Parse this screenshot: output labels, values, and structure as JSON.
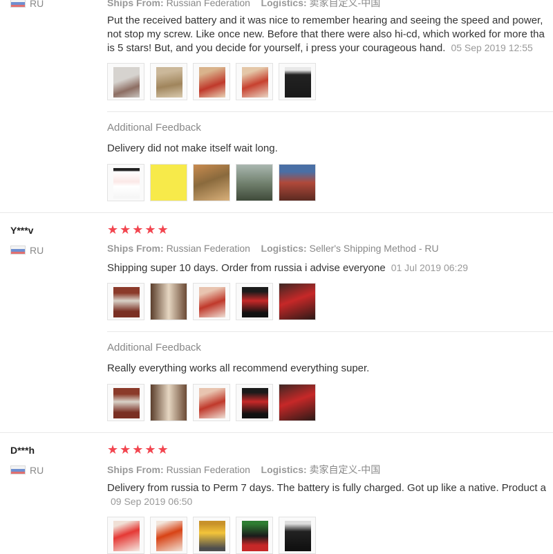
{
  "reviews": [
    {
      "country": "RU",
      "ships_label": "Ships From:",
      "ships_value": "Russian Federation",
      "logistics_label": "Logistics:",
      "logistics_value": "卖家自定义-中国",
      "text1": "Put the received battery and it was nice to remember hearing and seeing the speed and power,",
      "text2": "not stop my screw. Like once new. Before that there were also hi-cd, which worked for more tha",
      "text3": "is 5 stars! But, and you decide for yourself, i press your courageous hand.",
      "date": "05 Sep 2019 12:55",
      "additional": {
        "label": "Additional Feedback",
        "text": "Delivery did not make itself wait long."
      }
    },
    {
      "name": "Y***v",
      "country": "RU",
      "stars": "★★★★★",
      "ships_label": "Ships From:",
      "ships_value": "Russian Federation",
      "logistics_label": "Logistics:",
      "logistics_value": "Seller's Shipping Method - RU",
      "text": "Shipping super 10 days. Order from russia i advise everyone",
      "date": "01 Jul 2019 06:29",
      "additional": {
        "label": "Additional Feedback",
        "text": "Really everything works all recommend everything super."
      }
    },
    {
      "name": "D***h",
      "country": "RU",
      "stars": "★★★★★",
      "ships_label": "Ships From:",
      "ships_value": "Russian Federation",
      "logistics_label": "Logistics:",
      "logistics_value": "卖家自定义-中国",
      "text": "Delivery from russia to Perm 7 days. The battery is fully charged. Got up like a native. Product a",
      "date": "09 Sep 2019 06:50"
    }
  ],
  "colors": {
    "star": "#f2454f",
    "muted": "#999999",
    "text": "#333333"
  }
}
